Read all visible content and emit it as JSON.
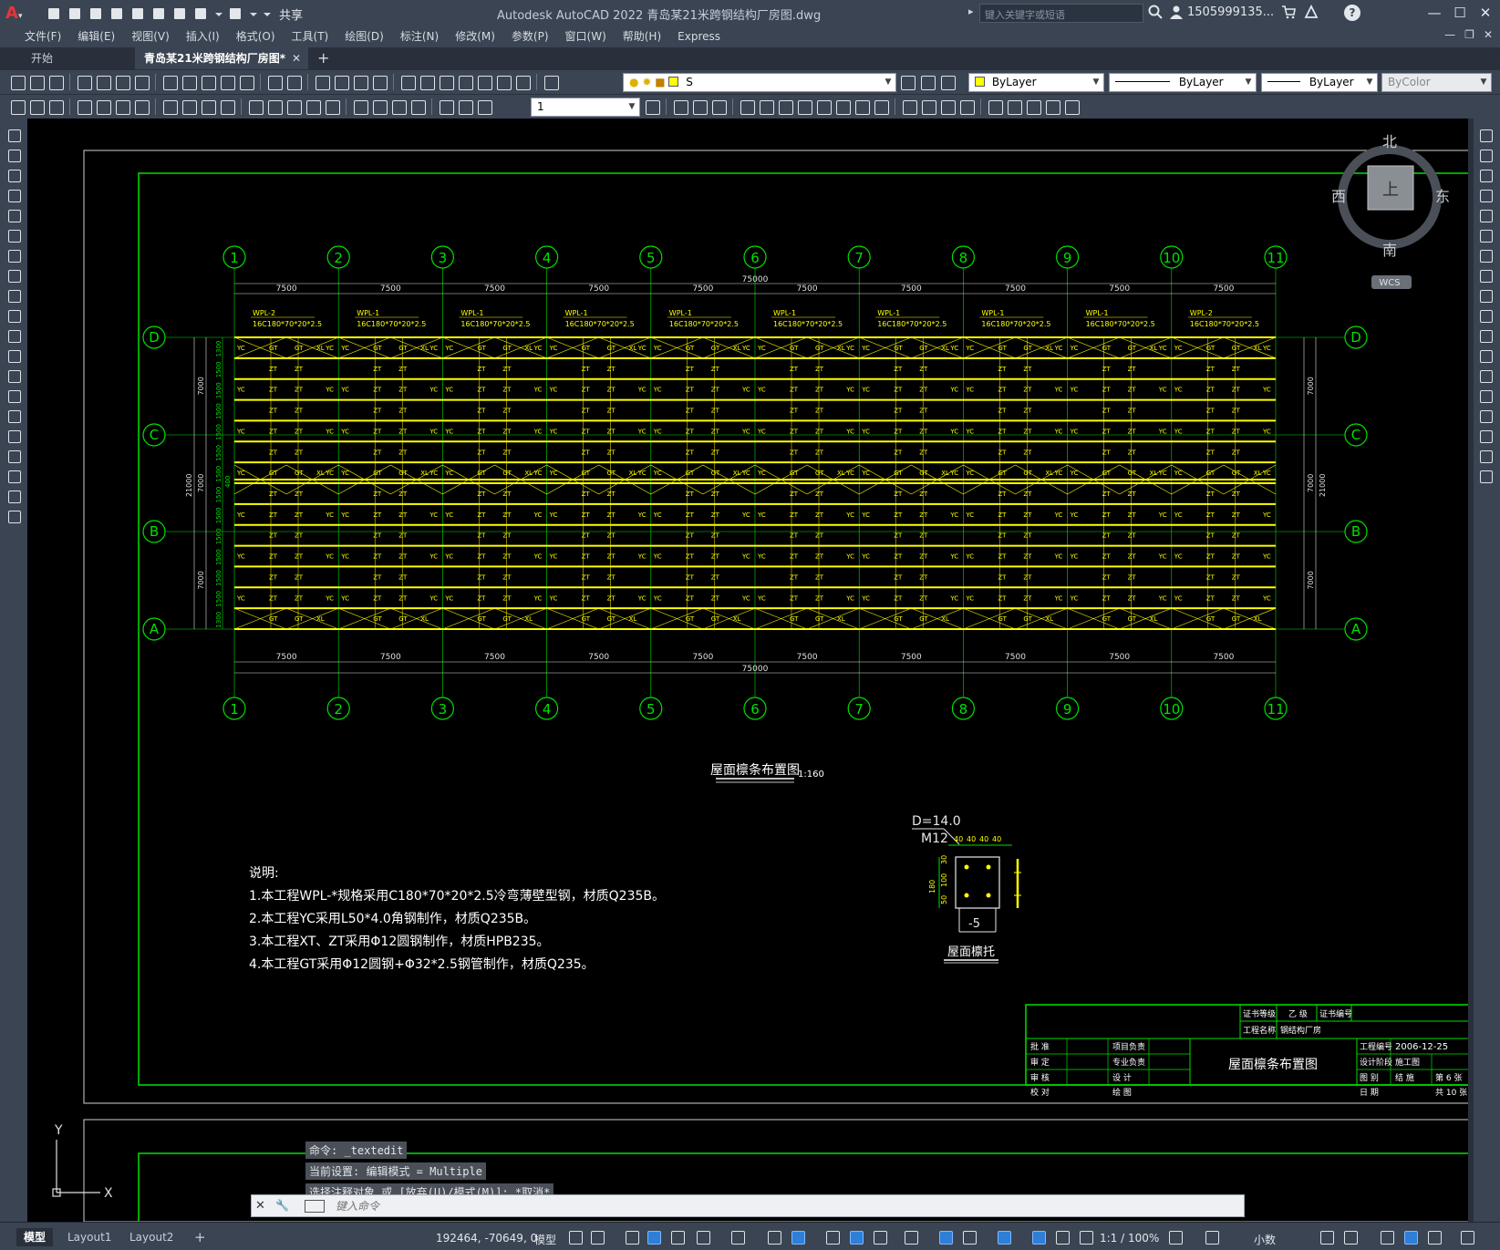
{
  "titlebar": {
    "share_label": "共享",
    "window_title": "Autodesk AutoCAD 2022    青岛某21米跨钢结构厂房图.dwg",
    "search_placeholder": "键入关键字或短语",
    "user_name": "1505999135...",
    "help": "?"
  },
  "menu": [
    "文件(F)",
    "编辑(E)",
    "视图(V)",
    "插入(I)",
    "格式(O)",
    "工具(T)",
    "绘图(D)",
    "标注(N)",
    "修改(M)",
    "参数(P)",
    "窗口(W)",
    "帮助(H)",
    "Express"
  ],
  "tabs": {
    "start": "开始",
    "drawing": "青岛某21米跨钢结构厂房图*",
    "close": "✕",
    "add": "+"
  },
  "properties": {
    "layer": "S",
    "color": "ByLayer",
    "linetype": "ByLayer",
    "lineweight": "ByLayer",
    "plotstyle": "ByColor",
    "dimscale": "1",
    "layer_color": "#ffff00"
  },
  "viewcube": {
    "north": "北",
    "south": "南",
    "east": "东",
    "west": "西",
    "top": "上",
    "wcs": "WCS"
  },
  "drawing": {
    "grid_top_labels": [
      "1",
      "2",
      "3",
      "4",
      "5",
      "6",
      "7",
      "8",
      "9",
      "10",
      "11"
    ],
    "grid_row_labels": [
      "D",
      "C",
      "B",
      "A"
    ],
    "bay_dim": "7500",
    "total_dim": "75000",
    "span_dim": "7000",
    "total_span_dim": "21000",
    "purlin_label_end": "WPL-2",
    "purlin_label_mid": "WPL-1",
    "purlin_spec": "16C180*70*20*2.5",
    "member_labels": [
      "YC",
      "GT",
      "XL",
      "ZT"
    ],
    "left_spacing_top": "1300",
    "left_spacing": "1500",
    "left_spacing_mid": "400",
    "plan_title": "屋面檩条布置图",
    "plan_scale": "1:160",
    "detail_d": "D=14.0",
    "detail_bolt": "M12",
    "detail_dims_top": [
      "40",
      "40",
      "40",
      "40"
    ],
    "detail_dims_side": [
      "180",
      "50",
      "100",
      "30"
    ],
    "detail_plate": "-5",
    "detail_title": "屋面檩托",
    "notes": [
      "说明:",
      "1.本工程WPL-*规格采用C180*70*20*2.5冷弯薄壁型钢，材质Q235B。",
      "2.本工程YC采用L50*4.0角钢制作，材质Q235B。",
      "3.本工程XT、ZT采用Φ12圆钢制作，材质HPB235。",
      "4.本工程GT采用Φ12圆钢+Φ32*2.5钢管制作，材质Q235。"
    ],
    "title_block": {
      "cert_level_label": "证书等级",
      "cert_level": "乙 级",
      "cert_no_label": "证书编号",
      "project_name_label": "工程名称",
      "project_name": "钢结构厂房",
      "approve": "批 准",
      "review": "审 定",
      "audit": "审 核",
      "check": "校 对",
      "project_lead": "项目负责",
      "discipline_lead": "专业负责",
      "design": "设 计",
      "draw": "绘 图",
      "drawing_title": "屋面檩条布置图",
      "project_no_label": "工程编号",
      "date": "2006-12-25",
      "stage_label": "设计阶段",
      "stage": "施工图",
      "sheet_no_label": "图 别",
      "sheet_type": "结 施",
      "sheet_no": "第 6 张",
      "date_label": "日 期",
      "total_sheets": "共 10 张"
    }
  },
  "ucs": {
    "y": "Y",
    "x": "X"
  },
  "command": {
    "history": [
      "命令: _textedit",
      "当前设置: 编辑模式 = Multiple",
      "选择注释对象 或 [放弃(U)/模式(M)]: *取消*"
    ],
    "placeholder": "键入命令"
  },
  "status": {
    "layout_tabs": [
      "模型",
      "Layout1",
      "Layout2"
    ],
    "coords": "192464, -70649, 0",
    "model": "模型",
    "scale": "1:1 / 100%",
    "units": "小数"
  }
}
